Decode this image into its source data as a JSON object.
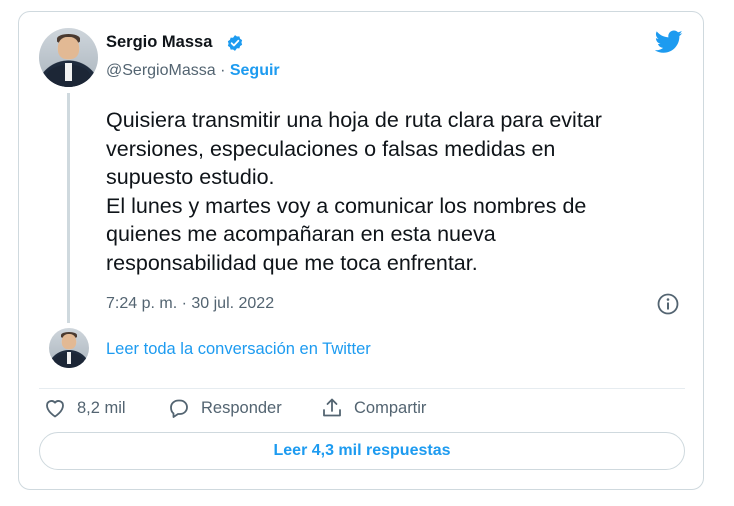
{
  "tweet": {
    "author_name": "Sergio Massa",
    "handle": "@SergioMassa",
    "separator": " · ",
    "follow_label": "Seguir",
    "text": "Quisiera transmitir una hoja de ruta clara para evitar\nversiones, especulaciones o falsas medidas en\nsupuesto estudio.\nEl lunes y martes voy a comunicar los nombres de\nquienes me acompañaran en esta nueva\nresponsabilidad que me toca enfrentar.",
    "timestamp": "7:24 p. m. · 30 jul. 2022",
    "read_conversation": "Leer toda la conversación en Twitter",
    "likes_count": "8,2 mil",
    "reply_label": "Responder",
    "share_label": "Compartir",
    "read_replies": "Leer 4,3 mil respuestas"
  },
  "icons": {
    "verified": "verified-badge-icon",
    "brand": "twitter-bird-icon",
    "info": "info-icon",
    "like": "heart-icon",
    "reply": "reply-bubble-icon",
    "share": "share-icon"
  },
  "colors": {
    "accent": "#1d9bf0",
    "text": "#0f1419",
    "secondary": "#536471",
    "border": "#cfd9de"
  }
}
